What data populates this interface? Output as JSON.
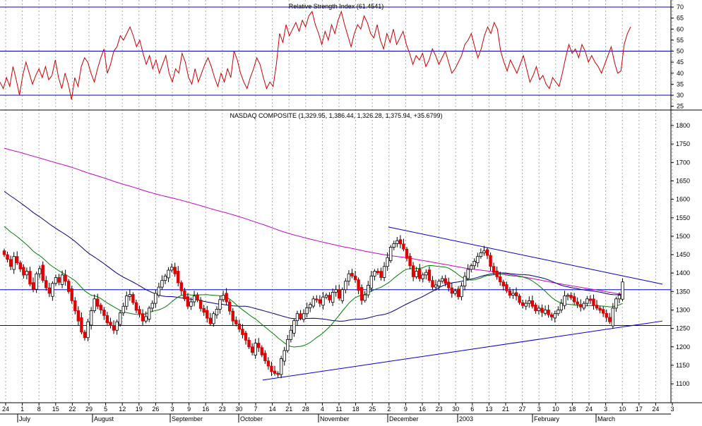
{
  "chart_data": {
    "type": "candlestick",
    "rsi_panel": {
      "title": "Relative Strength Index (61.4541)",
      "yticks": [
        25,
        30,
        35,
        40,
        45,
        50,
        55,
        60,
        65,
        70
      ],
      "ylim": [
        25,
        72
      ],
      "reference_lines": [
        30,
        50,
        70
      ],
      "color": "#d00000",
      "values": [
        36,
        33,
        38,
        34,
        43,
        37,
        30,
        39,
        45,
        40,
        35,
        39,
        42,
        38,
        43,
        37,
        39,
        46,
        38,
        33,
        40,
        35,
        28,
        38,
        34,
        43,
        47,
        45,
        40,
        36,
        42,
        47,
        51,
        40,
        44,
        50,
        52,
        57,
        55,
        58,
        61,
        57,
        52,
        55,
        49,
        44,
        48,
        42,
        46,
        40,
        44,
        48,
        40,
        36,
        42,
        40,
        49,
        45,
        38,
        35,
        42,
        36,
        40,
        44,
        47,
        43,
        38,
        34,
        40,
        36,
        42,
        38,
        50,
        46,
        40,
        36,
        33,
        38,
        42,
        47,
        44,
        38,
        33,
        36,
        34,
        44,
        58,
        54,
        62,
        57,
        60,
        63,
        59,
        64,
        61,
        66,
        68,
        62,
        58,
        53,
        59,
        55,
        62,
        58,
        64,
        68,
        62,
        57,
        52,
        58,
        62,
        60,
        66,
        63,
        58,
        56,
        62,
        55,
        51,
        58,
        54,
        60,
        53,
        56,
        59,
        53,
        49,
        44,
        48,
        46,
        49,
        43,
        46,
        51,
        48,
        44,
        47,
        50,
        45,
        40,
        42,
        45,
        48,
        53,
        55,
        58,
        52,
        47,
        51,
        57,
        61,
        58,
        63,
        60,
        50,
        45,
        41,
        46,
        43,
        40,
        44,
        48,
        42,
        36,
        39,
        43,
        37,
        39,
        35,
        33,
        38,
        36,
        34,
        40,
        47,
        53,
        49,
        51,
        47,
        53,
        50,
        45,
        48,
        45,
        43,
        40,
        44,
        48,
        52,
        45,
        40,
        41,
        53,
        58,
        61
      ]
    },
    "price_panel": {
      "title": "NASDAQ COMPOSITE (1,329.95, 1,386.44, 1,326.28, 1,375.94, +35.6799)",
      "yticks": [
        1100,
        1150,
        1200,
        1250,
        1300,
        1350,
        1400,
        1450,
        1500,
        1550,
        1600,
        1650,
        1700,
        1750,
        1800
      ],
      "ylim": [
        1072,
        1830
      ],
      "horizontal_lines": [
        1355,
        1258
      ],
      "trendlines": [
        {
          "from_date": "2002-11-29",
          "from_value": 1525,
          "to_date": "2003-03-24",
          "to_value": 1370,
          "color": "#0000cc"
        },
        {
          "from_date": "2002-10-09",
          "from_value": 1110,
          "to_date": "2003-03-24",
          "to_value": 1270,
          "color": "#0000cc"
        }
      ],
      "up_color": "#ffffff",
      "down_color": "#e00000",
      "closes": [
        1450,
        1437,
        1418,
        1445,
        1428,
        1411,
        1395,
        1405,
        1370,
        1356,
        1398,
        1412,
        1380,
        1360,
        1345,
        1372,
        1388,
        1375,
        1395,
        1378,
        1350,
        1325,
        1298,
        1270,
        1240,
        1225,
        1268,
        1298,
        1330,
        1310,
        1300,
        1285,
        1265,
        1258,
        1245,
        1268,
        1292,
        1310,
        1338,
        1342,
        1320,
        1299,
        1290,
        1270,
        1282,
        1305,
        1318,
        1345,
        1362,
        1380,
        1392,
        1408,
        1416,
        1398,
        1374,
        1352,
        1330,
        1310,
        1322,
        1338,
        1327,
        1304,
        1294,
        1278,
        1263,
        1290,
        1302,
        1328,
        1340,
        1322,
        1297,
        1270,
        1262,
        1248,
        1233,
        1218,
        1200,
        1185,
        1210,
        1198,
        1178,
        1162,
        1148,
        1133,
        1128,
        1125,
        1168,
        1190,
        1220,
        1245,
        1271,
        1290,
        1278,
        1290,
        1306,
        1315,
        1330,
        1328,
        1318,
        1335,
        1340,
        1327,
        1348,
        1355,
        1332,
        1355,
        1378,
        1398,
        1392,
        1382,
        1353,
        1326,
        1341,
        1367,
        1392,
        1405,
        1401,
        1388,
        1418,
        1442,
        1470,
        1480,
        1488,
        1479,
        1465,
        1440,
        1420,
        1390,
        1405,
        1385,
        1395,
        1402,
        1380,
        1362,
        1368,
        1378,
        1385,
        1372,
        1360,
        1345,
        1352,
        1336,
        1365,
        1391,
        1410,
        1420,
        1432,
        1445,
        1455,
        1460,
        1448,
        1418,
        1402,
        1390,
        1376,
        1365,
        1352,
        1340,
        1345,
        1338,
        1320,
        1312,
        1318,
        1325,
        1310,
        1298,
        1305,
        1293,
        1300,
        1287,
        1281,
        1290,
        1300,
        1318,
        1338,
        1340,
        1333,
        1322,
        1315,
        1308,
        1318,
        1330,
        1326,
        1313,
        1305,
        1299,
        1291,
        1280,
        1268,
        1305,
        1330,
        1340,
        1376
      ]
    },
    "x_axis": {
      "day_ticks": [
        "24",
        "1",
        "8",
        "15",
        "22",
        "29",
        "5",
        "12",
        "19",
        "26",
        "3",
        "9",
        "16",
        "23",
        "30",
        "7",
        "14",
        "21",
        "28",
        "4",
        "11",
        "18",
        "25",
        "2",
        "9",
        "16",
        "23",
        "30",
        "6",
        "13",
        "21",
        "27",
        "3",
        "10",
        "18",
        "24",
        "3",
        "10",
        "17",
        "24",
        "3"
      ],
      "month_labels": [
        "July",
        "August",
        "September",
        "October",
        "November",
        "December",
        "2003",
        "February",
        "March"
      ]
    }
  }
}
